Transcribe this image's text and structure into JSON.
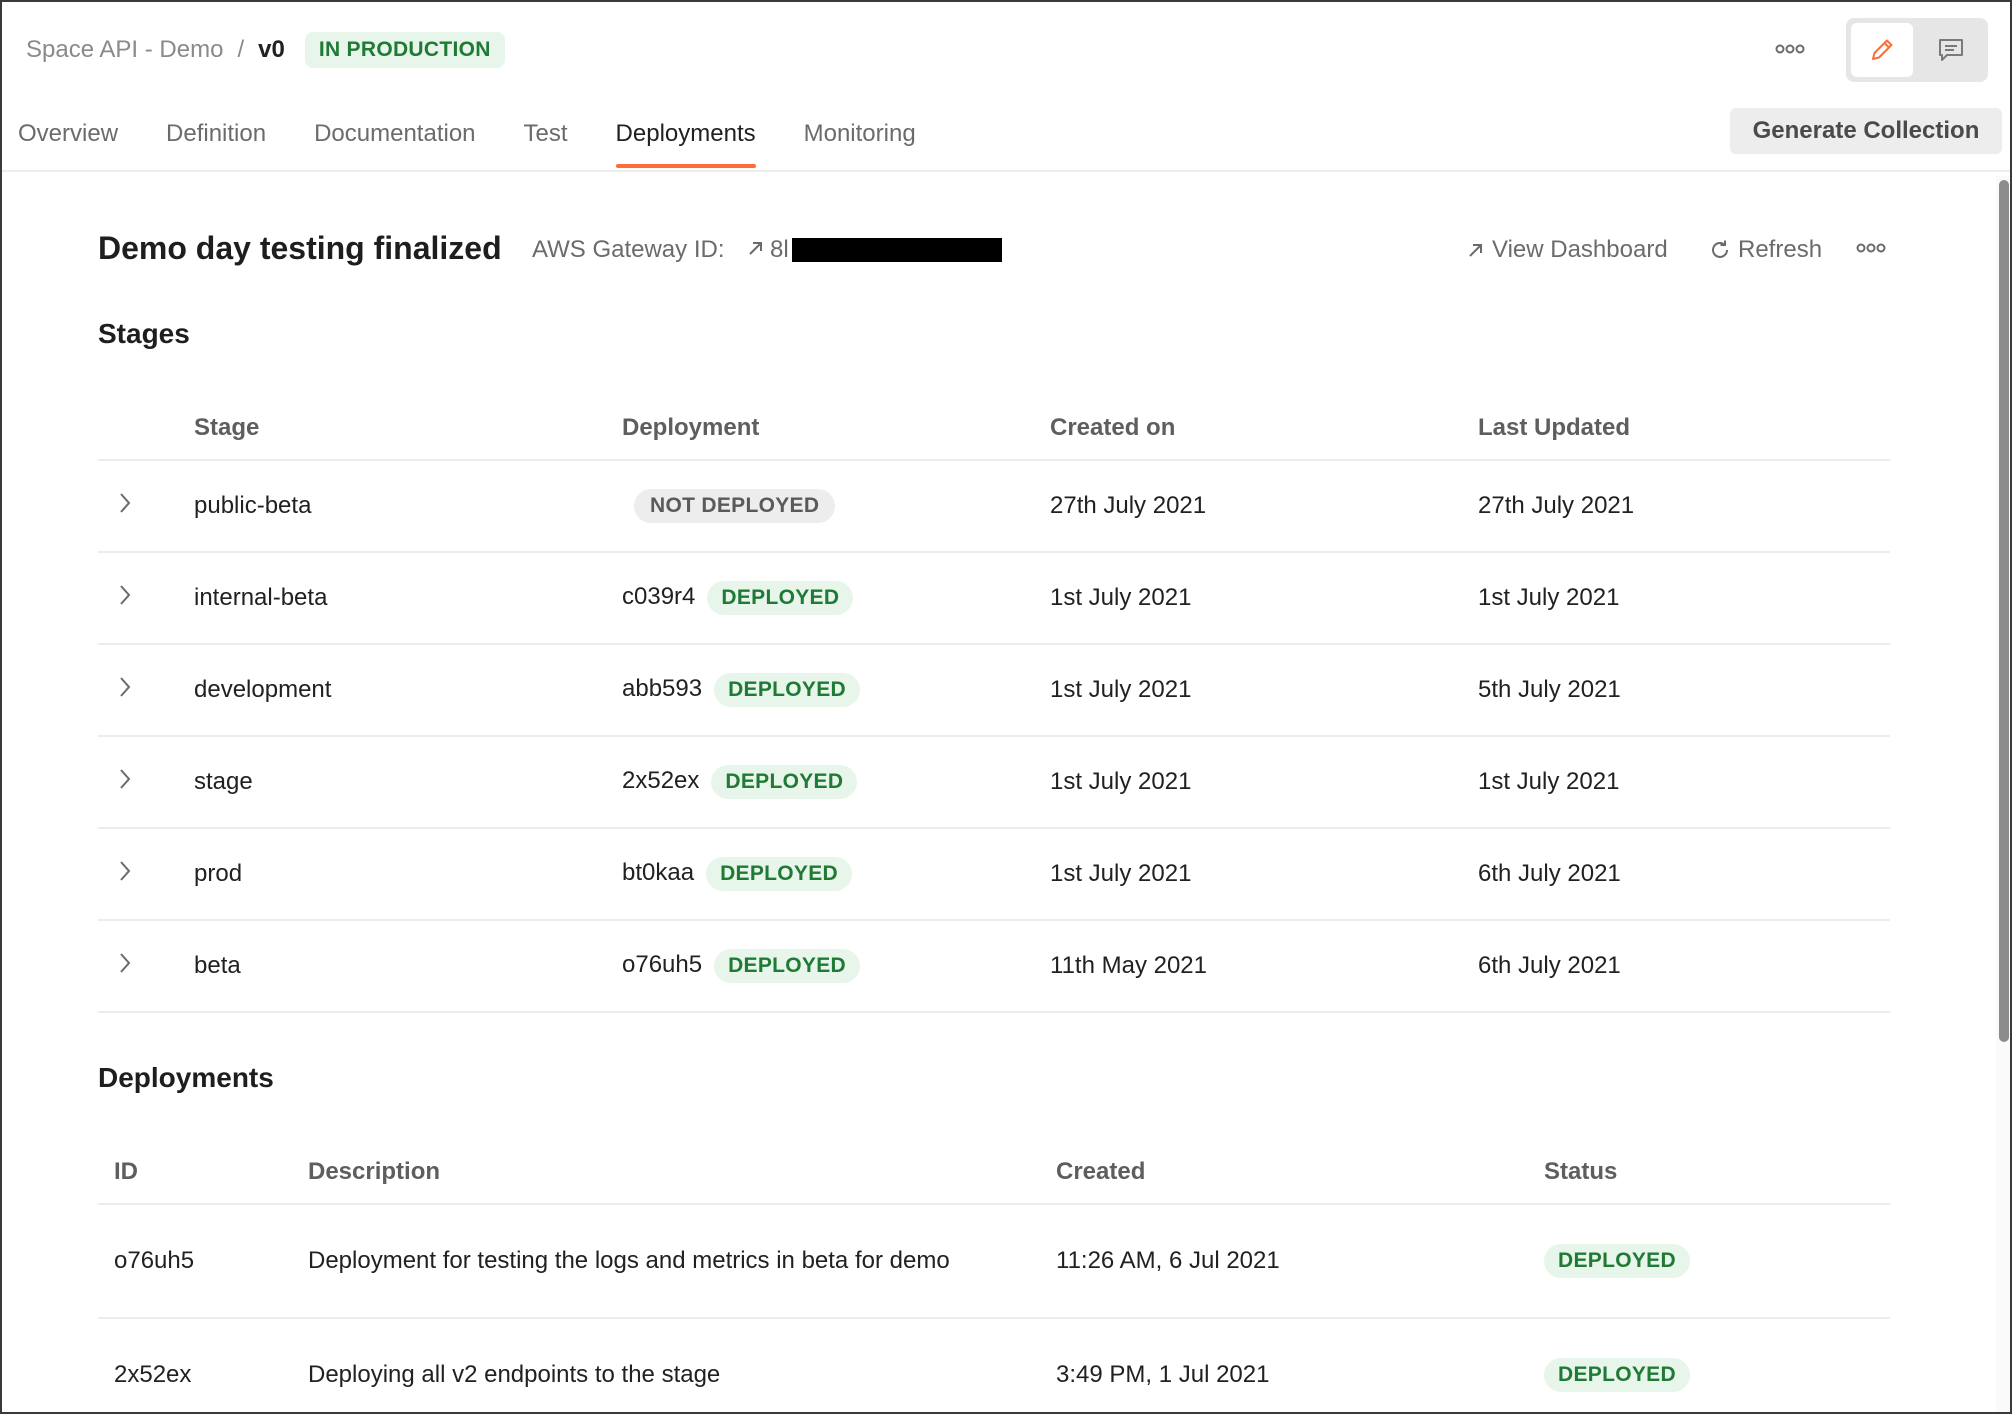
{
  "breadcrumb": {
    "parent": "Space API - Demo",
    "separator": "/",
    "version": "v0",
    "status_badge": "IN PRODUCTION"
  },
  "header": {
    "more_icon": "more-horizontal-icon",
    "edit_icon": "pencil-icon",
    "comment_icon": "comment-icon",
    "generate_collection_label": "Generate Collection"
  },
  "tabs": [
    {
      "label": "Overview",
      "active": false
    },
    {
      "label": "Definition",
      "active": false
    },
    {
      "label": "Documentation",
      "active": false
    },
    {
      "label": "Test",
      "active": false
    },
    {
      "label": "Deployments",
      "active": true
    },
    {
      "label": "Monitoring",
      "active": false
    }
  ],
  "page": {
    "title": "Demo day testing finalized",
    "gateway_label": "AWS Gateway ID:",
    "gateway_value_visible": "8l",
    "view_dashboard_label": "View Dashboard",
    "refresh_label": "Refresh"
  },
  "stages": {
    "section_title": "Stages",
    "columns": [
      "Stage",
      "Deployment",
      "Created on",
      "Last Updated"
    ],
    "rows": [
      {
        "stage": "public-beta",
        "deployment_id": "",
        "status": "NOT DEPLOYED",
        "created_on": "27th July 2021",
        "last_updated": "27th July 2021"
      },
      {
        "stage": "internal-beta",
        "deployment_id": "c039r4",
        "status": "DEPLOYED",
        "created_on": "1st July 2021",
        "last_updated": "1st July 2021"
      },
      {
        "stage": "development",
        "deployment_id": "abb593",
        "status": "DEPLOYED",
        "created_on": "1st July 2021",
        "last_updated": "5th July 2021"
      },
      {
        "stage": "stage",
        "deployment_id": "2x52ex",
        "status": "DEPLOYED",
        "created_on": "1st July 2021",
        "last_updated": "1st July 2021"
      },
      {
        "stage": "prod",
        "deployment_id": "bt0kaa",
        "status": "DEPLOYED",
        "created_on": "1st July 2021",
        "last_updated": "6th July 2021"
      },
      {
        "stage": "beta",
        "deployment_id": "o76uh5",
        "status": "DEPLOYED",
        "created_on": "11th May 2021",
        "last_updated": "6th July 2021"
      }
    ]
  },
  "deployments": {
    "section_title": "Deployments",
    "columns": [
      "ID",
      "Description",
      "Created",
      "Status"
    ],
    "rows": [
      {
        "id": "o76uh5",
        "description": "Deployment for testing the logs and metrics in beta for demo",
        "created": "11:26 AM, 6 Jul 2021",
        "status": "DEPLOYED"
      },
      {
        "id": "2x52ex",
        "description": "Deploying all v2 endpoints to the stage",
        "created": "3:49 PM, 1 Jul 2021",
        "status": "DEPLOYED"
      }
    ]
  },
  "colors": {
    "accent": "#ff6c37",
    "success_bg": "#e8f5ea",
    "success_text": "#1f7a35",
    "neutral_bg": "#ededed"
  }
}
